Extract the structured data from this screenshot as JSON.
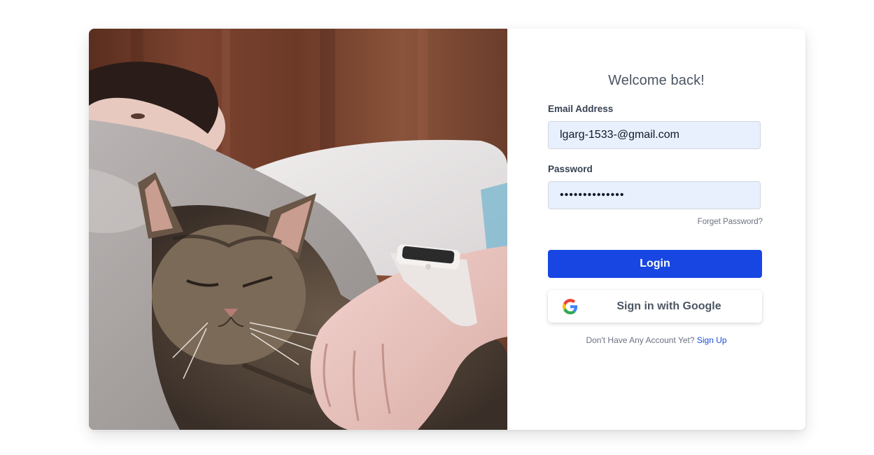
{
  "login": {
    "title": "Welcome back!",
    "email_label": "Email Address",
    "email_value": "lgarg-1533-@gmail.com",
    "password_label": "Password",
    "password_value": "••••••••••••••",
    "forgot_password": "Forget Password?",
    "login_button": "Login",
    "google_button": "Sign in with Google",
    "signup_prompt": "Don't Have Any Account Yet?",
    "signup_link": "Sign Up"
  },
  "colors": {
    "primary": "#1746e2",
    "input_bg": "#e8f0fe",
    "link": "#1d4ed8",
    "heading": "#4b5563"
  },
  "icons": {
    "google": "google-logo-icon"
  },
  "photo": {
    "subject": "person-lying-with-tabby-cat"
  }
}
